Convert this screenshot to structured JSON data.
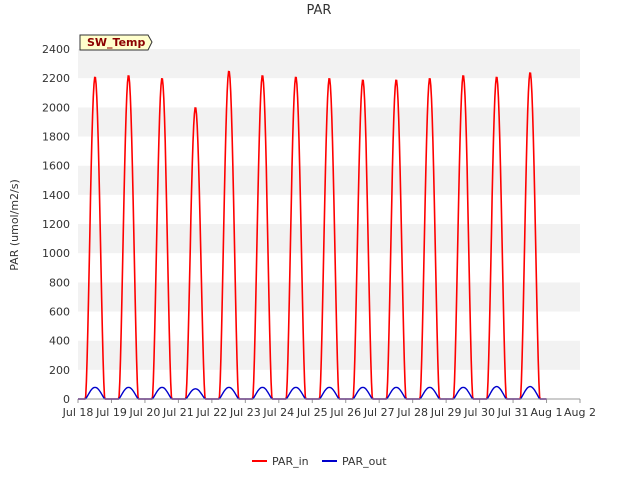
{
  "chart_data": {
    "type": "line",
    "title": "PAR",
    "xlabel": "",
    "ylabel": "PAR (umol/m2/s)",
    "tag": "SW_Temp",
    "ylim": [
      0,
      2400
    ],
    "yticks": [
      0,
      200,
      400,
      600,
      800,
      1000,
      1200,
      1400,
      1600,
      1800,
      2000,
      2200,
      2400
    ],
    "xlim": [
      "2024-07-18",
      "2024-08-02"
    ],
    "xtick_labels": [
      "Jul 18",
      "Jul 19",
      "Jul 20",
      "Jul 21",
      "Jul 22",
      "Jul 23",
      "Jul 24",
      "Jul 25",
      "Jul 26",
      "Jul 27",
      "Jul 28",
      "Jul 29",
      "Jul 30",
      "Jul 31",
      "Aug 1",
      "Aug 2"
    ],
    "grid": "horizontal bands",
    "legend_position": "bottom",
    "series": [
      {
        "name": "PAR_in",
        "color": "#ff0000",
        "daily_peaks": [
          {
            "date": "2024-07-18",
            "peak": 2210
          },
          {
            "date": "2024-07-19",
            "peak": 2220
          },
          {
            "date": "2024-07-20",
            "peak": 2200
          },
          {
            "date": "2024-07-21",
            "peak": 2000
          },
          {
            "date": "2024-07-22",
            "peak": 2250
          },
          {
            "date": "2024-07-23",
            "peak": 2220
          },
          {
            "date": "2024-07-24",
            "peak": 2210
          },
          {
            "date": "2024-07-25",
            "peak": 2200
          },
          {
            "date": "2024-07-26",
            "peak": 2190
          },
          {
            "date": "2024-07-27",
            "peak": 2190
          },
          {
            "date": "2024-07-28",
            "peak": 2200
          },
          {
            "date": "2024-07-29",
            "peak": 2220
          },
          {
            "date": "2024-07-30",
            "peak": 2210
          },
          {
            "date": "2024-07-31",
            "peak": 2240
          }
        ]
      },
      {
        "name": "PAR_out",
        "color": "#0000cc",
        "daily_peaks": [
          {
            "date": "2024-07-18",
            "peak": 80
          },
          {
            "date": "2024-07-19",
            "peak": 80
          },
          {
            "date": "2024-07-20",
            "peak": 80
          },
          {
            "date": "2024-07-21",
            "peak": 70
          },
          {
            "date": "2024-07-22",
            "peak": 80
          },
          {
            "date": "2024-07-23",
            "peak": 80
          },
          {
            "date": "2024-07-24",
            "peak": 80
          },
          {
            "date": "2024-07-25",
            "peak": 80
          },
          {
            "date": "2024-07-26",
            "peak": 80
          },
          {
            "date": "2024-07-27",
            "peak": 80
          },
          {
            "date": "2024-07-28",
            "peak": 80
          },
          {
            "date": "2024-07-29",
            "peak": 80
          },
          {
            "date": "2024-07-30",
            "peak": 85
          },
          {
            "date": "2024-07-31",
            "peak": 85
          }
        ]
      }
    ]
  }
}
